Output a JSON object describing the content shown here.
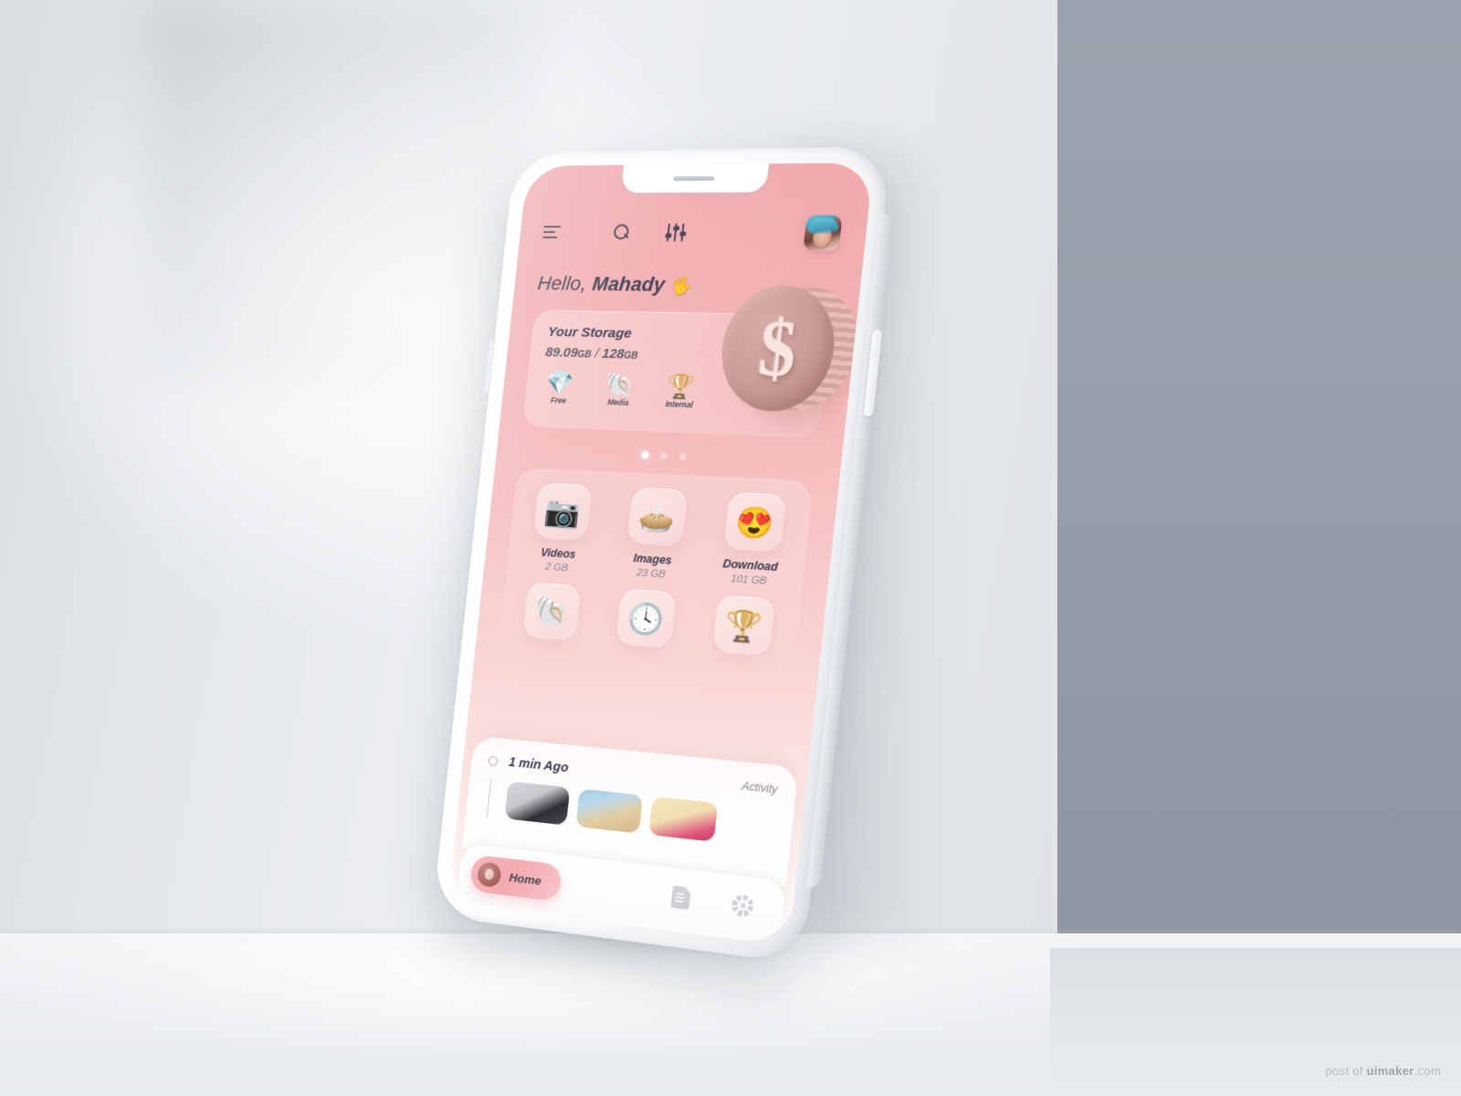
{
  "scene": {
    "watermark_prefix": "post of ",
    "watermark_brand": "uimaker",
    "watermark_suffix": ".com"
  },
  "app": {
    "topbar": {
      "menu_icon": "hamburger-menu-icon",
      "search_icon": "search-icon",
      "filter_icon": "filter-sliders-icon",
      "avatar_icon": "user-avatar"
    },
    "greeting": {
      "hello": "Hello,",
      "name": "Mahady",
      "wave": "🖐"
    },
    "storage": {
      "title": "Your Storage",
      "used": "89.09",
      "used_unit": "GB",
      "separator": " / ",
      "total": "128",
      "total_unit": "GB",
      "chips": [
        {
          "label": "Free",
          "glyph": "💎",
          "icon": "diamond-icon"
        },
        {
          "label": "Media",
          "glyph": "🐚",
          "icon": "shell-icon"
        },
        {
          "label": "Internal",
          "glyph": "🏆",
          "icon": "trophy-icon"
        }
      ],
      "coin_symbol": "$"
    },
    "carousel": {
      "total_dots": 3,
      "active_index": 0
    },
    "categories": [
      {
        "name": "Videos",
        "size": "2 GB",
        "glyph": "📷",
        "icon": "camera-icon"
      },
      {
        "name": "Images",
        "size": "23 GB",
        "glyph": "🥧",
        "icon": "pie-chart-icon"
      },
      {
        "name": "Download",
        "size": "101 GB",
        "glyph": "😍",
        "icon": "heart-eyes-emoji-icon"
      },
      {
        "name": "",
        "size": "",
        "glyph": "🐚",
        "icon": "shell-icon"
      },
      {
        "name": "",
        "size": "",
        "glyph": "🕓",
        "icon": "clock-icon"
      },
      {
        "name": "",
        "size": "",
        "glyph": "🏆",
        "icon": "trophy-icon"
      }
    ],
    "activity": {
      "time": "1 min Ago",
      "label": "Activity",
      "thumbnails": [
        "thumb-gray-dark",
        "thumb-blue-sky",
        "thumb-cream-pink"
      ]
    },
    "nav": {
      "home_label": "Home",
      "items": [
        "home",
        "files",
        "settings"
      ]
    }
  },
  "colors": {
    "screen_top_pink": "#f0a8ac",
    "screen_bottom": "#ffffff",
    "text_dark": "#3b3950",
    "text_muted": "#8b8894",
    "accent_pill": "#f3a9b0",
    "coin_rose": "#cb9d97",
    "wall_left": "#eceef1",
    "wall_right": "#979ea9"
  }
}
